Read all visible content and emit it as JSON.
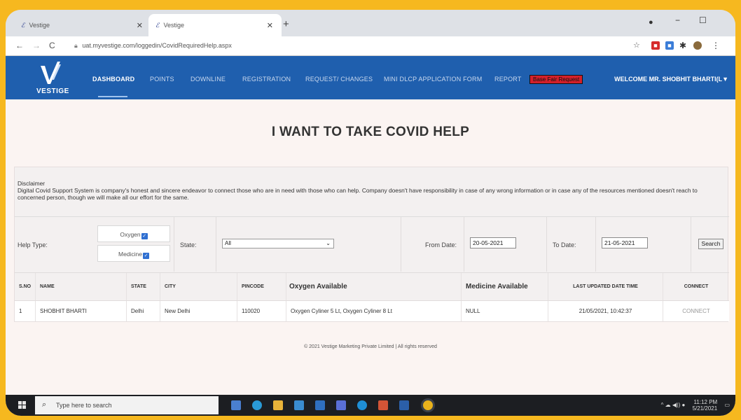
{
  "browser": {
    "tabs": [
      {
        "label": "Vestige"
      },
      {
        "label": "Vestige"
      }
    ],
    "new_tab": "+",
    "url": "uat.myvestige.com/loggedin/CovidRequiredHelp.aspx",
    "win_min": "−",
    "win_max": "☐"
  },
  "header": {
    "logo_text": "VESTIGE",
    "nav": [
      {
        "label": "DASHBOARD"
      },
      {
        "label": "POINTS"
      },
      {
        "label": "DOWNLINE"
      },
      {
        "label": "REGISTRATION"
      },
      {
        "label": "REQUEST/ CHANGES"
      },
      {
        "label": "MINI DLCP APPLICATION FORM"
      },
      {
        "label": "REPORT"
      }
    ],
    "red_link": "Base Fair Request",
    "welcome": "WELCOME MR. SHOBHIT BHARTI(L▼"
  },
  "page": {
    "title": "I WANT TO TAKE COVID HELP",
    "disclaimer_head": "Disclaimer",
    "disclaimer_body": "Digital Covid Support System is company's honest and sincere endeavor to connect those who are in need with those who can help. Company doesn't have responsibility in case of any wrong information or in case any of the resources mentioned doesn't reach to concerned person, though we will make all our effort for the same."
  },
  "filters": {
    "help_type_label": "Help Type:",
    "oxygen_label": "Oxygen",
    "medicine_label": "Medicine",
    "state_label": "State:",
    "state_value": "All",
    "from_label": "From Date:",
    "from_value": "20-05-2021",
    "to_label": "To Date:",
    "to_value": "21-05-2021",
    "search_label": "Search"
  },
  "table": {
    "headers": {
      "sno": "S.NO",
      "name": "NAME",
      "state": "STATE",
      "city": "CITY",
      "pincode": "PINCODE",
      "oxygen": "Oxygen Available",
      "medicine": "Medicine Available",
      "updated": "LAST UPDATED DATE TIME",
      "connect": "CONNECT"
    },
    "rows": [
      {
        "sno": "1",
        "name": "SHOBHIT BHARTI",
        "state": "Delhi",
        "city": "New Delhi",
        "pincode": "110020",
        "oxygen": "Oxygen Cyliner 5 Lt, Oxygen Cyliner 8 Lt",
        "medicine": "NULL",
        "updated": "21/05/2021, 10:42:37",
        "connect": "CONNECT"
      }
    ]
  },
  "footer": {
    "text": "© 2021 Vestige Marketing Private Limited | All rights reserved"
  },
  "taskbar": {
    "search_placeholder": "Type here to search",
    "time": "11:12 PM",
    "date": "5/21/2021"
  },
  "colors": {
    "page_border": "#f6b81f",
    "header_blue": "#1f5fae",
    "alert_red": "#d4202a"
  }
}
